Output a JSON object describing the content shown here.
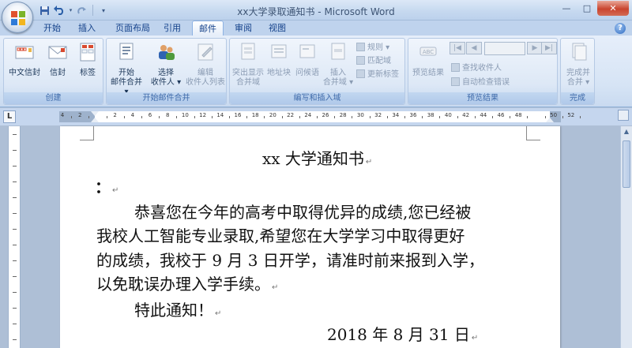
{
  "window": {
    "title": "xx大学录取通知书 - Microsoft Word",
    "controls": {
      "minimize": "—",
      "maximize": "□",
      "close": "✕"
    }
  },
  "qat": [
    "save-icon",
    "undo-icon",
    "redo-icon",
    "customize-icon"
  ],
  "tabs": [
    {
      "label": "开始",
      "active": false
    },
    {
      "label": "插入",
      "active": false
    },
    {
      "label": "页面布局",
      "active": false
    },
    {
      "label": "引用",
      "active": false
    },
    {
      "label": "邮件",
      "active": true
    },
    {
      "label": "审阅",
      "active": false
    },
    {
      "label": "视图",
      "active": false
    }
  ],
  "ribbon": {
    "create": {
      "label": "创建",
      "buttons": [
        "中文信封",
        "信封",
        "标签"
      ]
    },
    "start_merge": {
      "label": "开始邮件合并",
      "start": [
        "开始",
        "邮件合并 ▾"
      ],
      "select": [
        "选择",
        "收件人 ▾"
      ],
      "edit": [
        "编辑",
        "收件人列表"
      ]
    },
    "write_insert": {
      "label": "编写和插入域",
      "highlight": [
        "突出显示",
        "合并域"
      ],
      "address_block": "地址块",
      "greeting": "问候语",
      "insert_field": [
        "插入",
        "合并域 ▾"
      ],
      "rules": "规则 ▾",
      "match_fields": "匹配域",
      "update_labels": "更新标签"
    },
    "preview": {
      "label": "预览结果",
      "preview_button": "预览结果",
      "find_recipient": "查找收件人",
      "auto_check": "自动检查错误"
    },
    "finish": {
      "label": "完成",
      "button": [
        "完成并",
        "合并 ▾"
      ]
    }
  },
  "ruler": {
    "corner": "L",
    "numbers": [
      "4",
      "2",
      "",
      "2",
      "4",
      "6",
      "8",
      "10",
      "12",
      "14",
      "16",
      "18",
      "20",
      "22",
      "24",
      "26",
      "28",
      "30",
      "32",
      "34",
      "36",
      "38",
      "40",
      "42",
      "44",
      "46",
      "48",
      "",
      "50",
      "52"
    ]
  },
  "document": {
    "title": "xx 大学通知书",
    "salutation": "：",
    "paragraph_lines": [
      "恭喜您在今年的高考中取得优异的成绩,您已经被",
      "我校人工智能专业录取,希望您在大学学习中取得更好",
      "的成绩，我校于 9 月 3 日开学，请准时前来报到入学，",
      "以免耽误办理入学手续。"
    ],
    "closing": "特此通知！",
    "date": "2018 年 8 月 31 日",
    "paragraph_mark": "↵"
  },
  "colors": {
    "ribbon_bg": "#d6e4f5",
    "tab_text": "#15428b",
    "workspace_bg": "#aebfd6",
    "close_button": "#c9442e"
  }
}
